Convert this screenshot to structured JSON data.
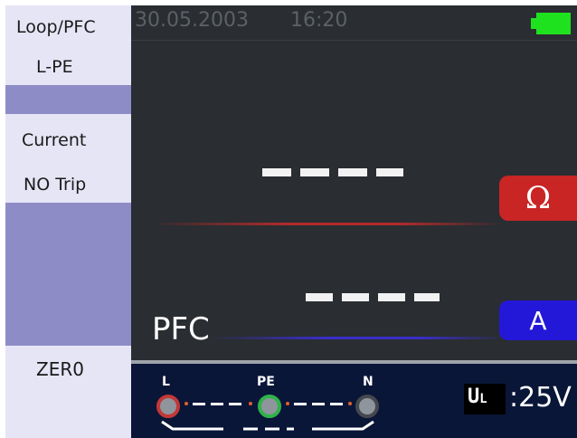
{
  "menu": {
    "function": "Loop/PFC",
    "connection": "L-PE",
    "current_label": "Current",
    "trip_mode": "NO Trip",
    "zero_button": "ZER0"
  },
  "status": {
    "date": "30.05.2003",
    "time": "16:20",
    "battery_level": 1.0,
    "battery_color": "#1fe21f"
  },
  "readings": {
    "primary_value": "- - - -",
    "primary_unit": "Ω",
    "secondary_value": "- - - -",
    "secondary_unit": "A",
    "mode": "PFC"
  },
  "terminals": [
    {
      "label": "L",
      "color": "#c23838"
    },
    {
      "label": "PE",
      "color": "#2fb34a"
    },
    {
      "label": "N",
      "color": "#44484e"
    }
  ],
  "test_voltage": {
    "label": "U",
    "subscript": "L",
    "separator": ":",
    "value": "25V"
  },
  "colors": {
    "menu_bg": "#8e8cc7",
    "menu_item_bg": "#e6e5f6",
    "display_bg": "#2a2d31",
    "ohm_button": "#c92525",
    "amp_button": "#2418d8",
    "bottom_bar": "#0a1638"
  }
}
